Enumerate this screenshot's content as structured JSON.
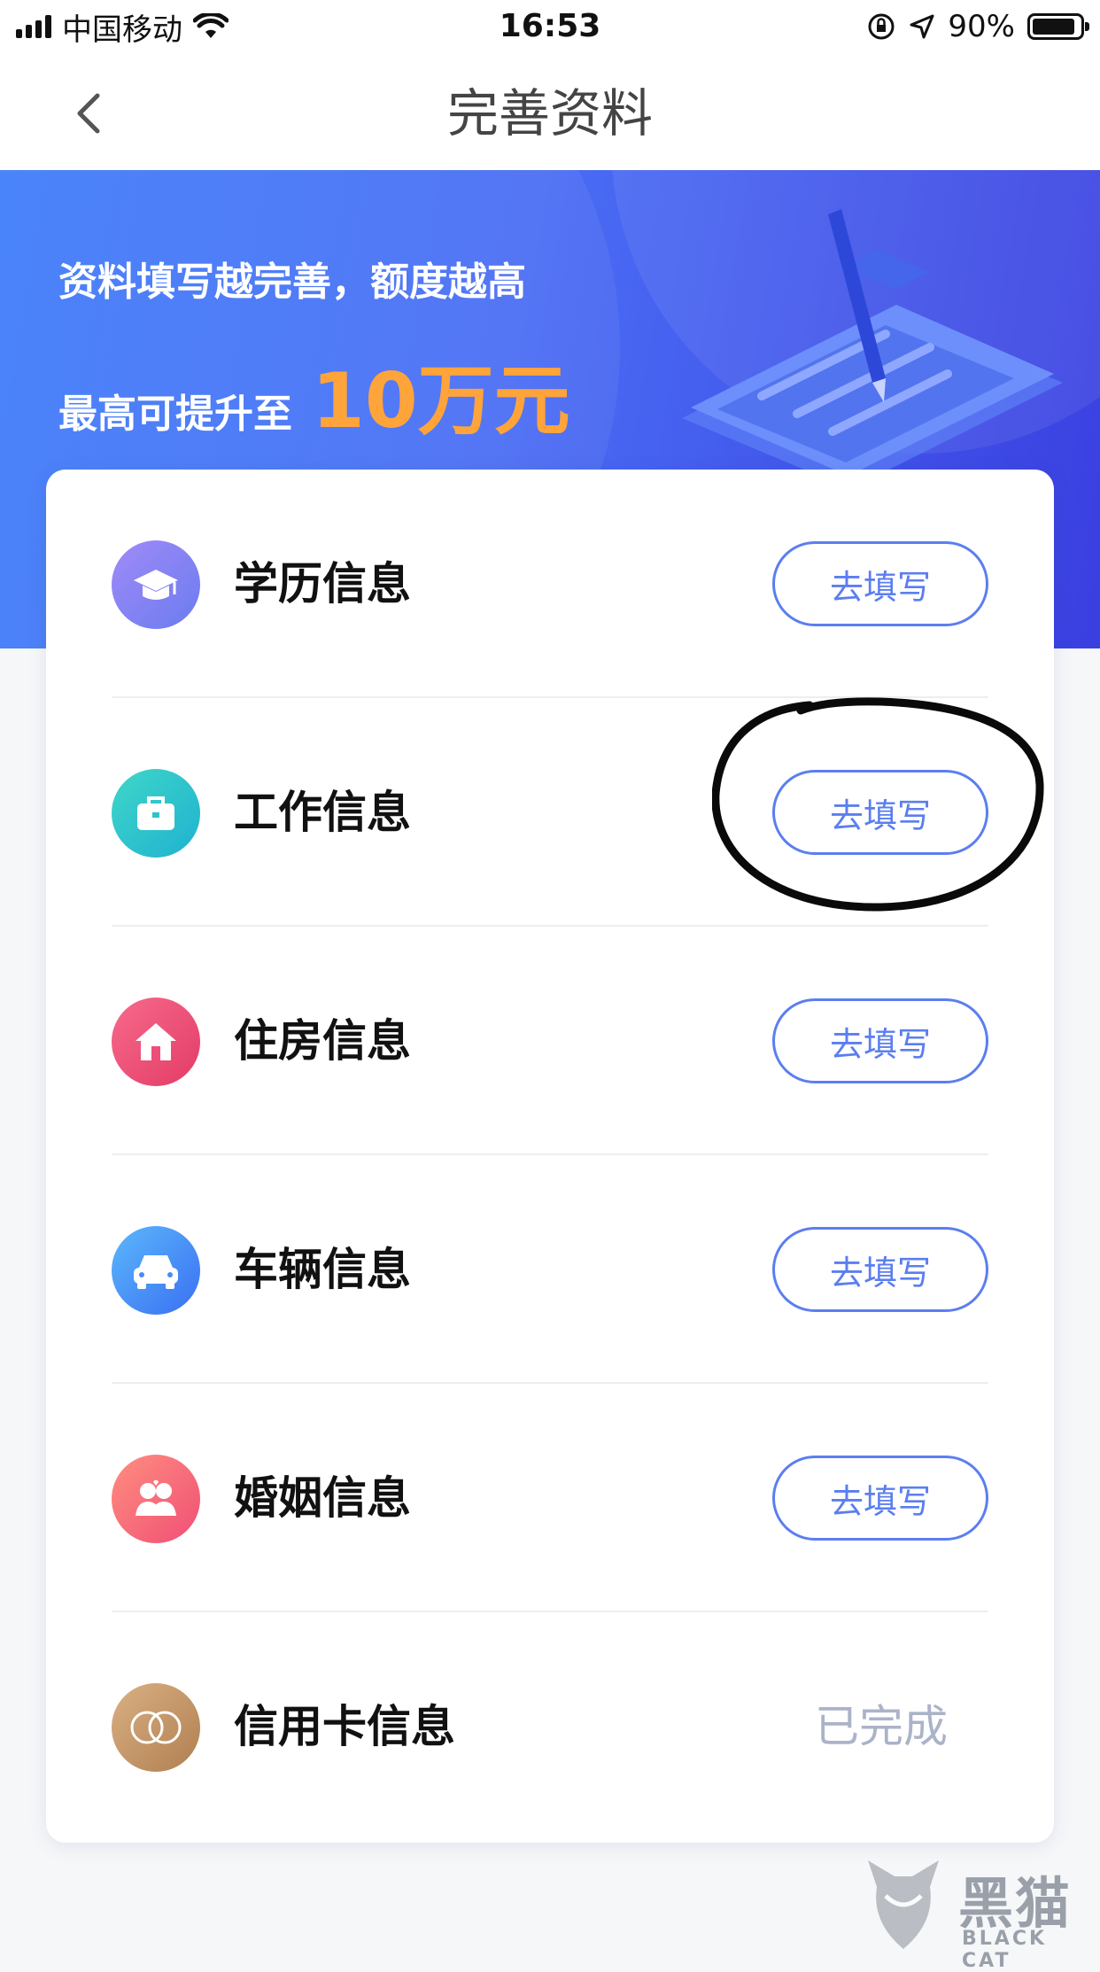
{
  "status_bar": {
    "carrier": "中国移动",
    "time": "16:53",
    "battery_text": "90%",
    "battery_level": 0.9
  },
  "navbar": {
    "title": "完善资料"
  },
  "banner": {
    "line1": "资料填写越完善，额度越高",
    "line2_prefix": "最高可提升至",
    "amount": "10万元"
  },
  "items": [
    {
      "label": "学历信息",
      "icon": "graduation-cap-icon",
      "color": "#7d7cf0",
      "action": "去填写",
      "status": "pending"
    },
    {
      "label": "工作信息",
      "icon": "briefcase-icon",
      "color": "#2bc4c8",
      "action": "去填写",
      "status": "pending"
    },
    {
      "label": "住房信息",
      "icon": "house-icon",
      "color": "#ee4f7a",
      "action": "去填写",
      "status": "pending"
    },
    {
      "label": "车辆信息",
      "icon": "car-icon",
      "color": "#4a8cf5",
      "action": "去填写",
      "status": "pending"
    },
    {
      "label": "婚姻信息",
      "icon": "couple-icon",
      "color": "#f2637a",
      "action": "去填写",
      "status": "pending"
    },
    {
      "label": "信用卡信息",
      "icon": "mastercard-icon",
      "color": "#c79a6a",
      "action": "已完成",
      "status": "done"
    }
  ],
  "watermark": {
    "text": "黑猫",
    "sub": "BLACK CAT"
  },
  "colors": {
    "accent": "#5b7ef0",
    "amount": "#ffa43a",
    "done_text": "#aab3c8"
  }
}
